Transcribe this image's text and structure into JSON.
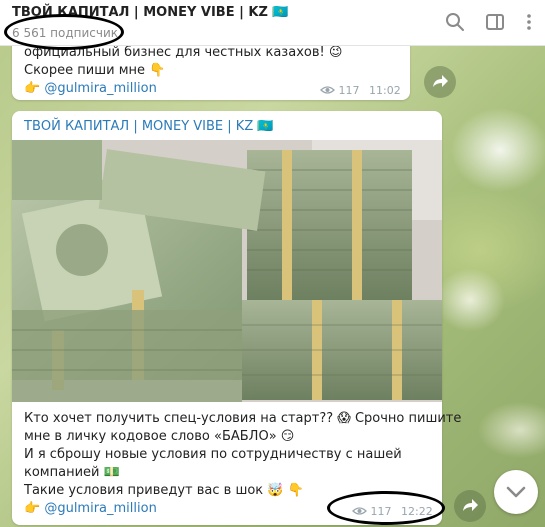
{
  "channel": {
    "title": "ТВОЙ КАПИТАЛ | MONEY VIBE | KZ 🇰🇿",
    "subscribers": "6 561 подписчик"
  },
  "messages": [
    {
      "lines": [
        "официальный бизнес для честных казахов! 😉",
        "Скорее пиши мне 👇"
      ],
      "mention_prefix": "👉",
      "mention": "@gulmira_million",
      "views": "117",
      "time": "11:02"
    },
    {
      "author": "ТВОЙ КАПИТАЛ | MONEY VIBE | KZ 🇰🇿",
      "photo_label": "stack of dollar banknotes",
      "lines": [
        "Кто хочет получить спец-условия на старт?? 😱 Срочно пишите",
        "мне в личку кодовое слово «БАБЛО» 😏",
        "И я сброшу новые условия по сотрудничеству с нашей",
        "компанией 💵",
        "Такие условия приведут вас в шок 🤯 👇"
      ],
      "mention_prefix": "👉",
      "mention": "@gulmira_million",
      "views": "117",
      "time": "12:22"
    }
  ],
  "icons": {
    "search": "search-icon",
    "sidebar": "sidebar-toggle-icon",
    "menu": "more-vertical-icon",
    "share": "forward-icon",
    "scroll": "chevron-down-icon",
    "views": "eye-icon"
  },
  "colors": {
    "accent": "#2b7bb9",
    "meta": "#9aa5ad"
  }
}
